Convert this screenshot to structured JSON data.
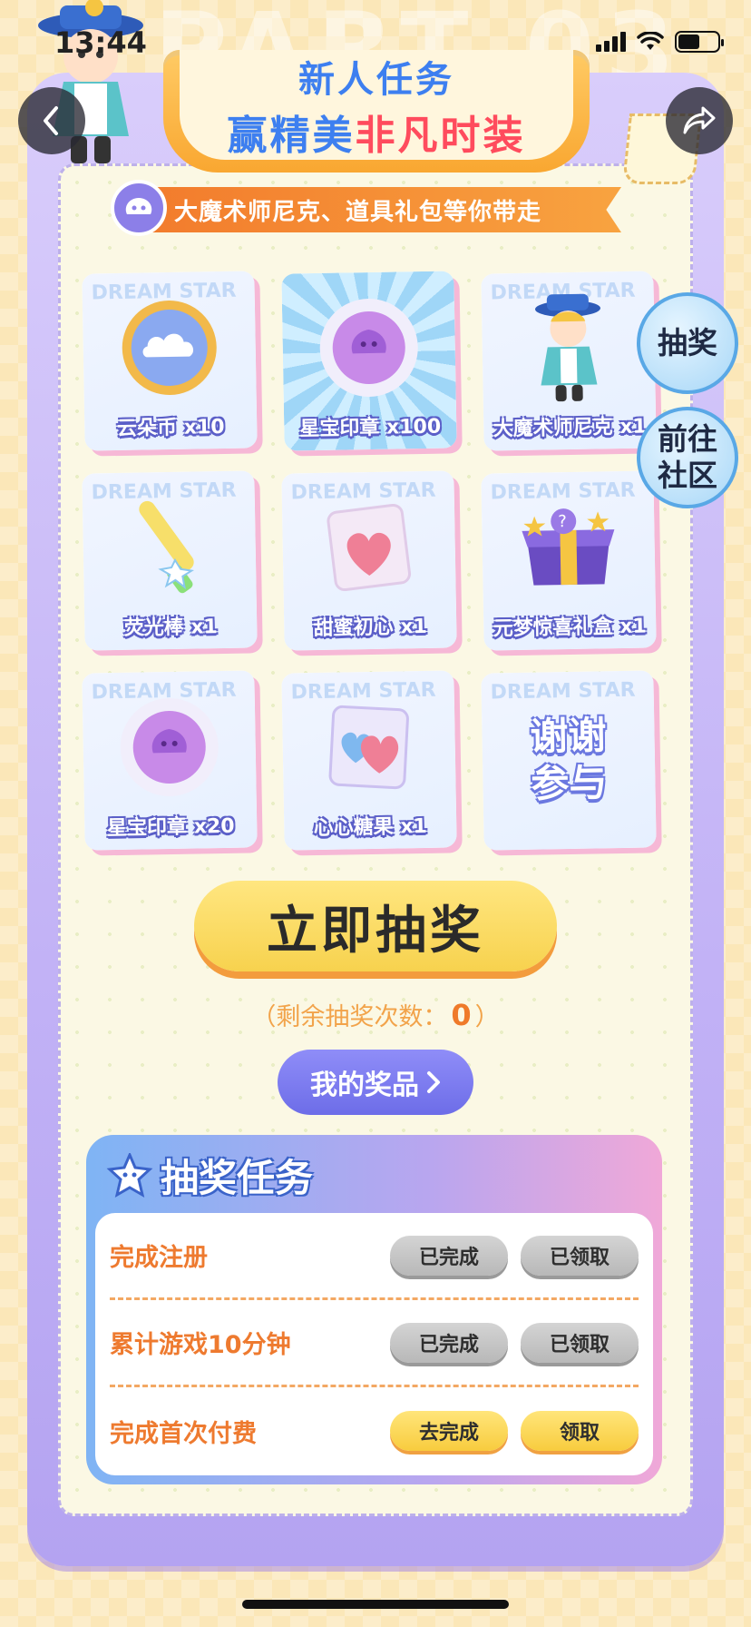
{
  "status_bar": {
    "time": "13:44"
  },
  "header": {
    "title_line1": "新人任务",
    "title_line2_prefix": "赢精美",
    "title_line2_highlight": "非凡时装",
    "subtitle": "大魔术师尼克、道具礼包等你带走"
  },
  "side_buttons": {
    "lottery": "抽奖",
    "community_line1": "前往",
    "community_line2": "社区"
  },
  "prizes": [
    {
      "label": "云朵币 x10",
      "icon": "cloud-coin-icon"
    },
    {
      "label": "星宝印章 x100",
      "icon": "star-seal-icon"
    },
    {
      "label": "大魔术师尼克 x1",
      "icon": "magician-nick-icon"
    },
    {
      "label": "荧光棒 x1",
      "icon": "glow-stick-icon"
    },
    {
      "label": "甜蜜初心 x1",
      "icon": "heart-candy-icon"
    },
    {
      "label": "元梦惊喜礼盒 x1",
      "icon": "gift-box-icon"
    },
    {
      "label": "星宝印章 x20",
      "icon": "star-seal-icon"
    },
    {
      "label": "心心糖果 x1",
      "icon": "hearts-candy-icon"
    },
    {
      "label_line1": "谢谢",
      "label_line2": "参与",
      "icon": "thanks-text"
    }
  ],
  "card_watermark": "DREAM STAR",
  "draw": {
    "button_label": "立即抽奖",
    "remaining_prefix": "（剩余抽奖次数：",
    "remaining_count": "0",
    "remaining_suffix": "）"
  },
  "my_prizes": {
    "label": "我的奖品"
  },
  "tasks": {
    "title": "抽奖任务",
    "rows": [
      {
        "name": "完成注册",
        "action": "已完成",
        "reward": "已领取",
        "state": "done"
      },
      {
        "name": "累计游戏10分钟",
        "action": "已完成",
        "reward": "已领取",
        "state": "done"
      },
      {
        "name": "完成首次付费",
        "action": "去完成",
        "reward": "领取",
        "state": "active"
      }
    ]
  },
  "colors": {
    "accent_blue": "#3d7ff0",
    "accent_red": "#ff4b5d",
    "accent_orange": "#ee7a2f",
    "purple": "#6d6de8"
  }
}
